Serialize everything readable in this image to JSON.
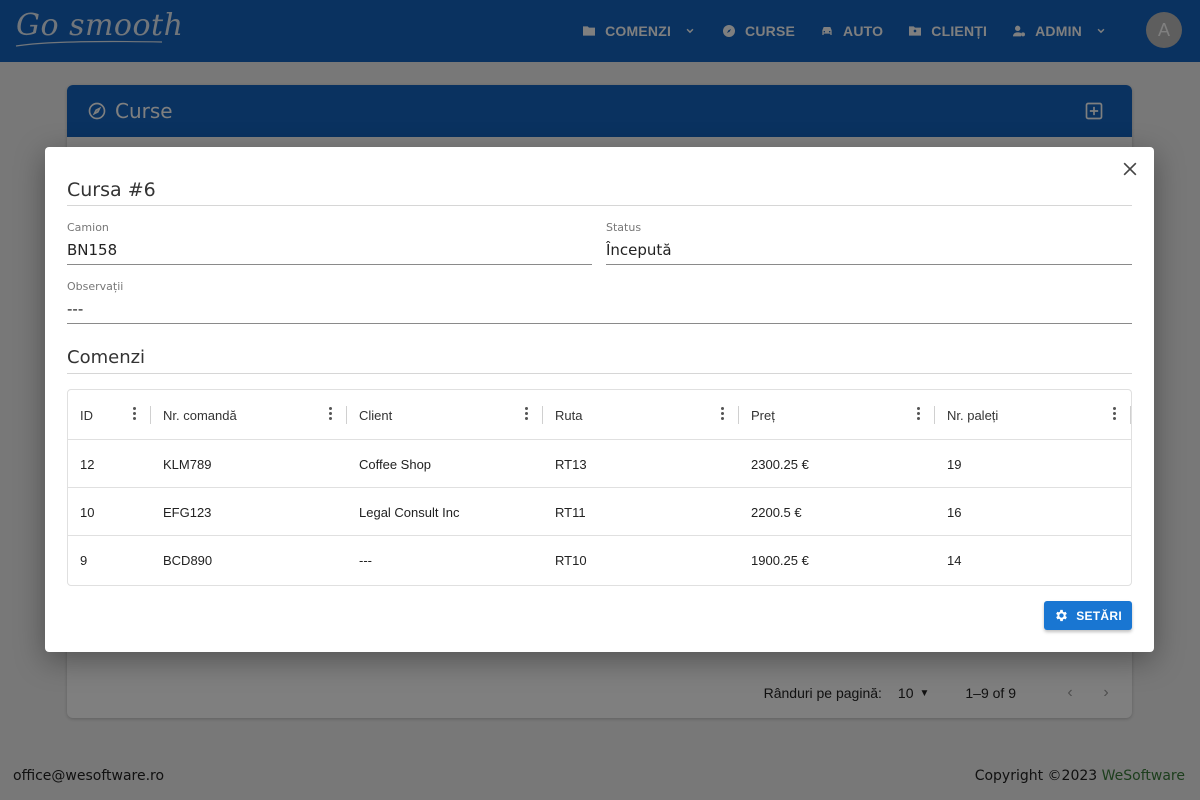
{
  "app": {
    "logo": "Go smooth"
  },
  "nav": [
    {
      "label": "COMENZI",
      "icon": "folder-icon",
      "dropdown": true
    },
    {
      "label": "CURSE",
      "icon": "compass-icon",
      "dropdown": false
    },
    {
      "label": "AUTO",
      "icon": "car-icon",
      "dropdown": false
    },
    {
      "label": "CLIENȚI",
      "icon": "contact-icon",
      "dropdown": false
    },
    {
      "label": "ADMIN",
      "icon": "admin-icon",
      "dropdown": true
    }
  ],
  "avatar": {
    "initial": "A"
  },
  "page": {
    "title": "Curse",
    "pagination": {
      "rows_per_page_label": "Rânduri pe pagină:",
      "rows_per_page": "10",
      "range": "1–9 of 9"
    }
  },
  "modal": {
    "title": "Cursa #6",
    "fields": {
      "truck": {
        "label": "Camion",
        "value": "BN158"
      },
      "status": {
        "label": "Status",
        "value": "Începută"
      },
      "notes": {
        "label": "Observații",
        "value": "---"
      }
    },
    "orders_title": "Comenzi",
    "table": {
      "columns": [
        "ID",
        "Nr. comandă",
        "Client",
        "Ruta",
        "Preț",
        "Nr. paleți"
      ],
      "rows": [
        [
          "12",
          "KLM789",
          "Coffee Shop",
          "RT13",
          "2300.25 €",
          "19"
        ],
        [
          "10",
          "EFG123",
          "Legal Consult Inc",
          "RT11",
          "2200.5 €",
          "16"
        ],
        [
          "9",
          "BCD890",
          "---",
          "RT10",
          "1900.25 €",
          "14"
        ]
      ]
    },
    "settings_button": "SETĂRI"
  },
  "footer": {
    "email": "office@wesoftware.ro",
    "copyright": "Copyright ©2023",
    "brand": "WeSoftware"
  },
  "colors": {
    "primary": "#1565c0",
    "button": "#1976d2",
    "brand_green": "#3a7d3a"
  }
}
